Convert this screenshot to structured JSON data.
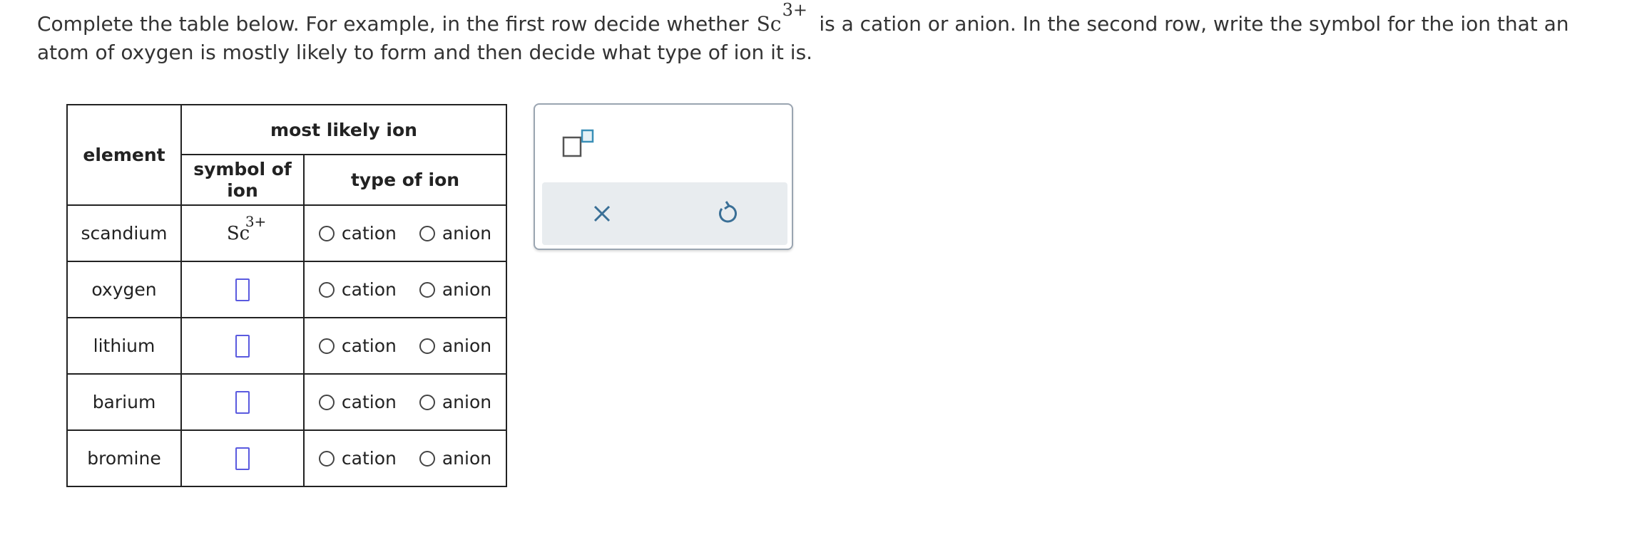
{
  "instructions": {
    "part1": "Complete the table below. For example, in the first row decide whether ",
    "example_symbol": "Sc",
    "example_charge": "3+",
    "part2": " is a cation or anion. In the second row, write the symbol for the ion that an atom of oxygen is mostly likely to form and then decide what type of ion it is."
  },
  "table": {
    "header_element": "element",
    "header_group": "most likely ion",
    "header_symbol": "symbol of ion",
    "header_type": "type of ion",
    "option_cation": "cation",
    "option_anion": "anion",
    "example_ion": {
      "symbol": "Sc",
      "charge": "3+"
    },
    "rows": [
      {
        "element": "scandium"
      },
      {
        "element": "oxygen"
      },
      {
        "element": "lithium"
      },
      {
        "element": "barium"
      },
      {
        "element": "bromine"
      }
    ]
  },
  "colors": {
    "input_border": "#5a5adf",
    "tool_accent": "#3a8fb7",
    "panel_border": "#9aa5b1",
    "action_bar_bg": "#e8ecef"
  },
  "icons": {
    "superscript_tool": "superscript-box-icon",
    "clear": "x-icon",
    "undo": "undo-icon"
  }
}
